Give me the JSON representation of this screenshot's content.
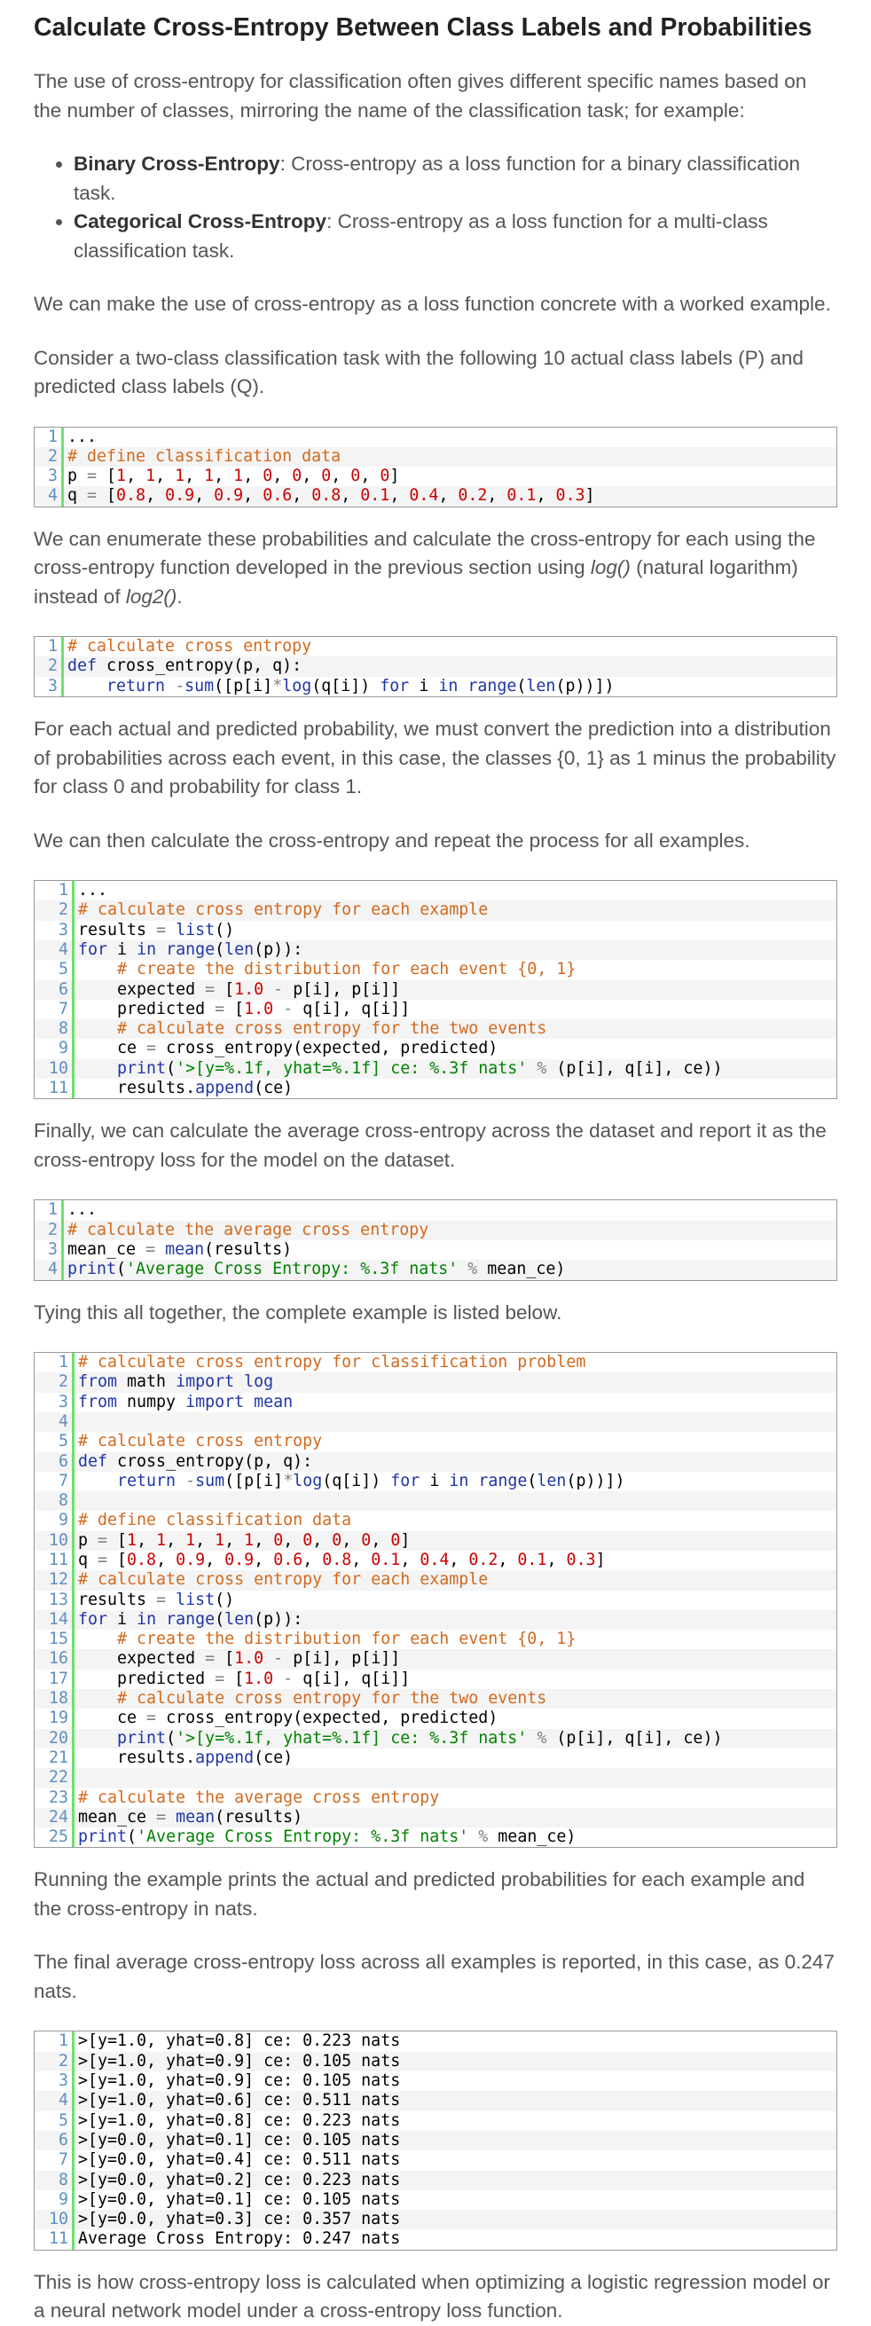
{
  "heading": "Calculate Cross-Entropy Between Class Labels and Probabilities",
  "intro": "The use of cross-entropy for classification often gives different specific names based on the number of classes, mirroring the name of the classification task; for example:",
  "bullets": [
    {
      "term": "Binary Cross-Entropy",
      "text": ": Cross-entropy as a loss function for a binary classification task."
    },
    {
      "term": "Categorical Cross-Entropy",
      "text": ": Cross-entropy as a loss function for a multi-class classification task."
    }
  ],
  "para_worked": "We can make the use of cross-entropy as a loss function concrete with a worked example.",
  "para_consider": "Consider a two-class classification task with the following 10 actual class labels (P) and predicted class labels (Q).",
  "para_enumerate_1": "We can enumerate these probabilities and calculate the cross-entropy for each using the cross-entropy function developed in the previous section using ",
  "para_enumerate_log": "log()",
  "para_enumerate_2": " (natural logarithm) instead of ",
  "para_enumerate_log2": "log2()",
  "para_enumerate_3": ".",
  "para_convert": "For each actual and predicted probability, we must convert the prediction into a distribution of probabilities across each event, in this case, the classes {0, 1} as 1 minus the probability for class 0 and probability for class 1.",
  "para_repeat": "We can then calculate the cross-entropy and repeat the process for all examples.",
  "para_average": "Finally, we can calculate the average cross-entropy across the dataset and report it as the cross-entropy loss for the model on the dataset.",
  "para_together": "Tying this all together, the complete example is listed below.",
  "para_running": "Running the example prints the actual and predicted probabilities for each example and the cross-entropy in nats.",
  "para_final": "The final average cross-entropy loss across all examples is reported, in this case, as 0.247 nats.",
  "para_closing": "This is how cross-entropy loss is calculated when optimizing a logistic regression model or a neural network model under a cross-entropy loss function.",
  "code_blocks": {
    "data": [
      "...",
      "# define classification data",
      "p = [1, 1, 1, 1, 1, 0, 0, 0, 0, 0]",
      "q = [0.8, 0.9, 0.9, 0.6, 0.8, 0.1, 0.4, 0.2, 0.1, 0.3]"
    ],
    "func": [
      "# calculate cross entropy",
      "def cross_entropy(p, q):",
      "    return -sum([p[i]*log(q[i]) for i in range(len(p))])"
    ],
    "loop": [
      "...",
      "# calculate cross entropy for each example",
      "results = list()",
      "for i in range(len(p)):",
      "    # create the distribution for each event {0, 1}",
      "    expected = [1.0 - p[i], p[i]]",
      "    predicted = [1.0 - q[i], q[i]]",
      "    # calculate cross entropy for the two events",
      "    ce = cross_entropy(expected, predicted)",
      "    print('>[y=%.1f, yhat=%.1f] ce: %.3f nats' % (p[i], q[i], ce))",
      "    results.append(ce)"
    ],
    "mean": [
      "...",
      "# calculate the average cross entropy",
      "mean_ce = mean(results)",
      "print('Average Cross Entropy: %.3f nats' % mean_ce)"
    ],
    "complete": [
      "# calculate cross entropy for classification problem",
      "from math import log",
      "from numpy import mean",
      "",
      "# calculate cross entropy",
      "def cross_entropy(p, q):",
      "    return -sum([p[i]*log(q[i]) for i in range(len(p))])",
      "",
      "# define classification data",
      "p = [1, 1, 1, 1, 1, 0, 0, 0, 0, 0]",
      "q = [0.8, 0.9, 0.9, 0.6, 0.8, 0.1, 0.4, 0.2, 0.1, 0.3]",
      "# calculate cross entropy for each example",
      "results = list()",
      "for i in range(len(p)):",
      "    # create the distribution for each event {0, 1}",
      "    expected = [1.0 - p[i], p[i]]",
      "    predicted = [1.0 - q[i], q[i]]",
      "    # calculate cross entropy for the two events",
      "    ce = cross_entropy(expected, predicted)",
      "    print('>[y=%.1f, yhat=%.1f] ce: %.3f nats' % (p[i], q[i], ce))",
      "    results.append(ce)",
      "",
      "# calculate the average cross entropy",
      "mean_ce = mean(results)",
      "print('Average Cross Entropy: %.3f nats' % mean_ce)"
    ],
    "output": [
      ">[y=1.0, yhat=0.8] ce: 0.223 nats",
      ">[y=1.0, yhat=0.9] ce: 0.105 nats",
      ">[y=1.0, yhat=0.9] ce: 0.105 nats",
      ">[y=1.0, yhat=0.6] ce: 0.511 nats",
      ">[y=1.0, yhat=0.8] ce: 0.223 nats",
      ">[y=0.0, yhat=0.1] ce: 0.105 nats",
      ">[y=0.0, yhat=0.4] ce: 0.511 nats",
      ">[y=0.0, yhat=0.2] ce: 0.223 nats",
      ">[y=0.0, yhat=0.1] ce: 0.105 nats",
      ">[y=0.0, yhat=0.3] ce: 0.357 nats",
      "Average Cross Entropy: 0.247 nats"
    ]
  }
}
